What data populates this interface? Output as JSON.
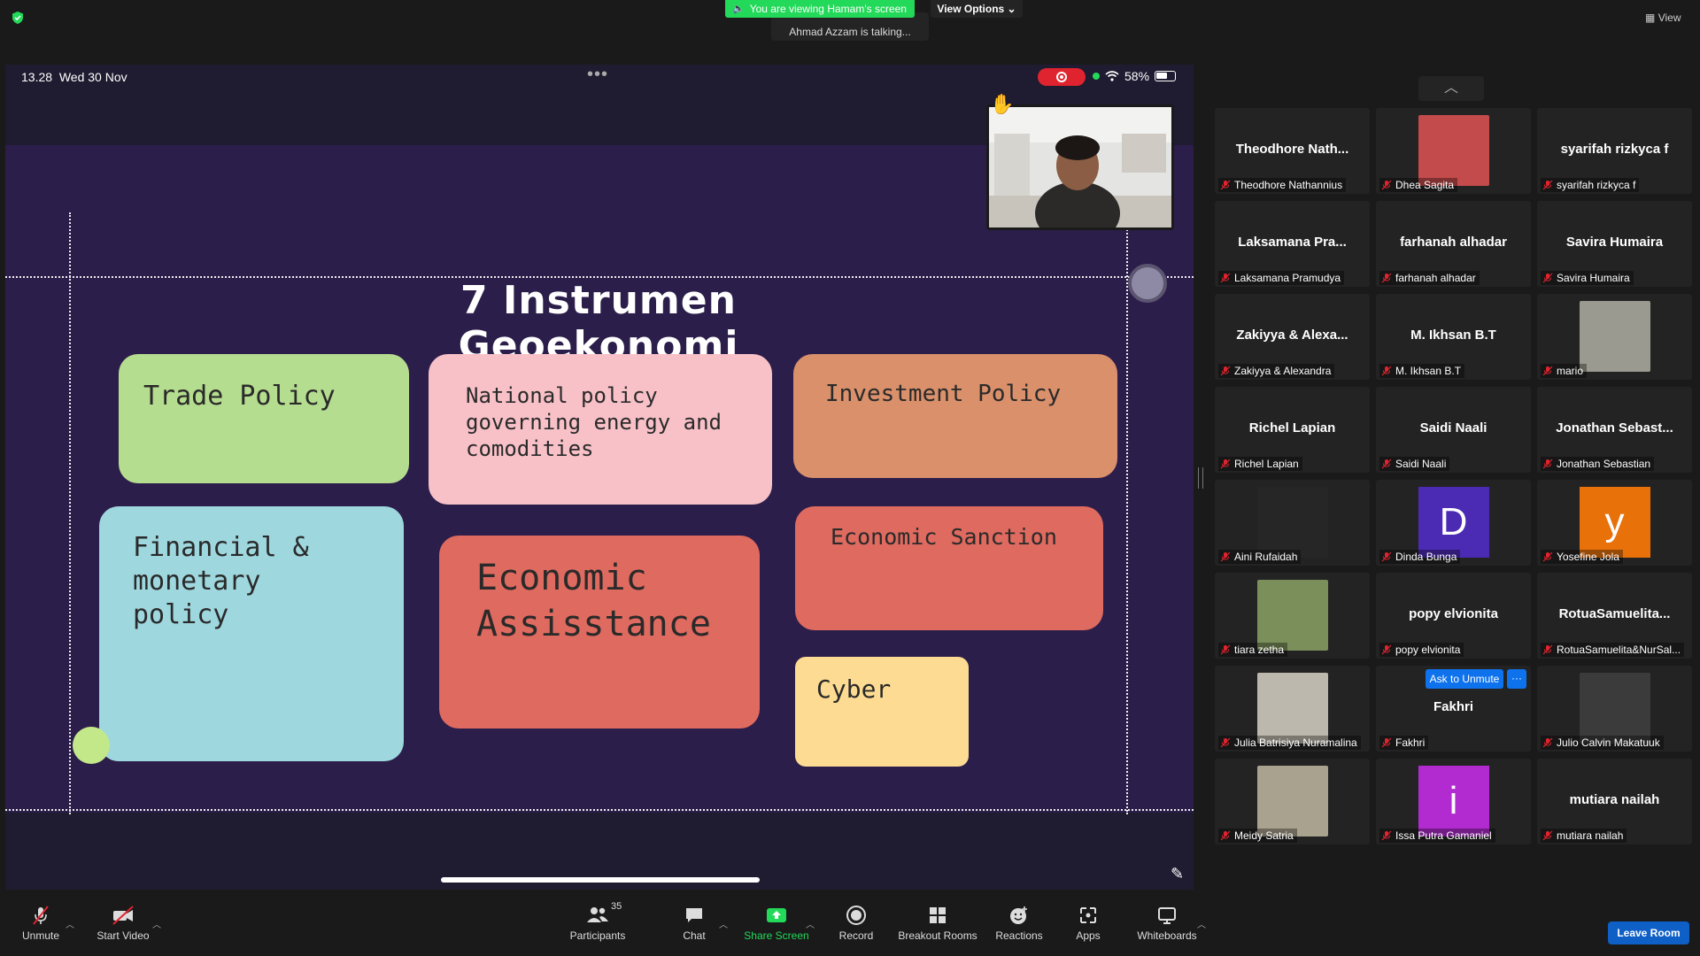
{
  "top": {
    "viewing_banner": "You are viewing Hamam's screen",
    "view_options": "View Options",
    "talking": "Ahmad Azzam is talking...",
    "view_label": "View"
  },
  "device_status": {
    "time": "13.28",
    "date": "Wed 30 Nov",
    "battery": "58%"
  },
  "slide": {
    "title": "7 Instrumen Geoekonomi",
    "cards": [
      {
        "id": "trade",
        "text": "Trade Policy",
        "color": "#b5dd8f"
      },
      {
        "id": "national",
        "text": "National policy governing energy and comodities",
        "color": "#f8c1c8"
      },
      {
        "id": "investment",
        "text": "Investment Policy",
        "color": "#d9906b"
      },
      {
        "id": "financial",
        "text": "Financial & monetary policy",
        "color": "#9ed7de"
      },
      {
        "id": "assistance",
        "text": "Economic Assisstance",
        "color": "#df6a5f"
      },
      {
        "id": "sanction",
        "text": "Economic Sanction",
        "color": "#df6a5f"
      },
      {
        "id": "cyber",
        "text": "Cyber",
        "color": "#fddb92"
      }
    ]
  },
  "participants": [
    {
      "display": "Theodhore  Nath...",
      "label": "Theodhore Nathannius"
    },
    {
      "display": "",
      "label": "Dhea Sagita",
      "photo": "#c44b4b"
    },
    {
      "display": "syarifah rizkyca f",
      "label": "syarifah rizkyca f"
    },
    {
      "display": "Laksamana  Pra...",
      "label": "Laksamana Pramudya"
    },
    {
      "display": "farhanah alhadar",
      "label": "farhanah alhadar"
    },
    {
      "display": "Savira Humaira",
      "label": "Savira Humaira"
    },
    {
      "display": "Zakiyya  &  Alexa...",
      "label": "Zakiyya & Alexandra"
    },
    {
      "display": "M. Ikhsan B.T",
      "label": "M. Ikhsan B.T"
    },
    {
      "display": "",
      "label": "mario",
      "photo": "#9a9a90"
    },
    {
      "display": "Richel Lapian",
      "label": "Richel Lapian"
    },
    {
      "display": "Saidi Naali",
      "label": "Saidi Naali"
    },
    {
      "display": "Jonathan  Sebast...",
      "label": "Jonathan Sebastian"
    },
    {
      "display": "",
      "label": "Aini Rufaidah",
      "photo": "#262626"
    },
    {
      "display": "",
      "label": "Dinda Bunga",
      "letter": "D",
      "letter_bg": "#4b2bb3"
    },
    {
      "display": "",
      "label": "Yosefine Jola",
      "letter": "y",
      "letter_bg": "#e8710a"
    },
    {
      "display": "",
      "label": "tiara zetha",
      "photo": "#7b8f5a"
    },
    {
      "display": "popy elvionita",
      "label": "popy elvionita"
    },
    {
      "display": "RotuaSamuelita...",
      "label": "RotuaSamuelita&NurSal..."
    },
    {
      "display": "",
      "label": "Julia Batrisiya Nuramalina",
      "photo": "#bdb8ad"
    },
    {
      "display": "Fakhri",
      "label": "Fakhri"
    },
    {
      "display": "",
      "label": "Julio Calvin Makatuuk",
      "photo": "#3b3b3b"
    },
    {
      "display": "",
      "label": "Meidy Satria",
      "photo": "#a9a28e"
    },
    {
      "display": "",
      "label": "Issa Putra Gamaniel",
      "letter": "i",
      "letter_bg": "#b12bd0"
    },
    {
      "display": "mutiara nailah",
      "label": "mutiara nailah"
    }
  ],
  "ask_to_unmute": "Ask to Unmute",
  "ask_more": "···",
  "toolbar": {
    "unmute": "Unmute",
    "start_video": "Start Video",
    "participants": "Participants",
    "participants_count": "35",
    "chat": "Chat",
    "share_screen": "Share Screen",
    "record": "Record",
    "breakout_rooms": "Breakout Rooms",
    "reactions": "Reactions",
    "apps": "Apps",
    "whiteboards": "Whiteboards",
    "leave_room": "Leave Room"
  }
}
